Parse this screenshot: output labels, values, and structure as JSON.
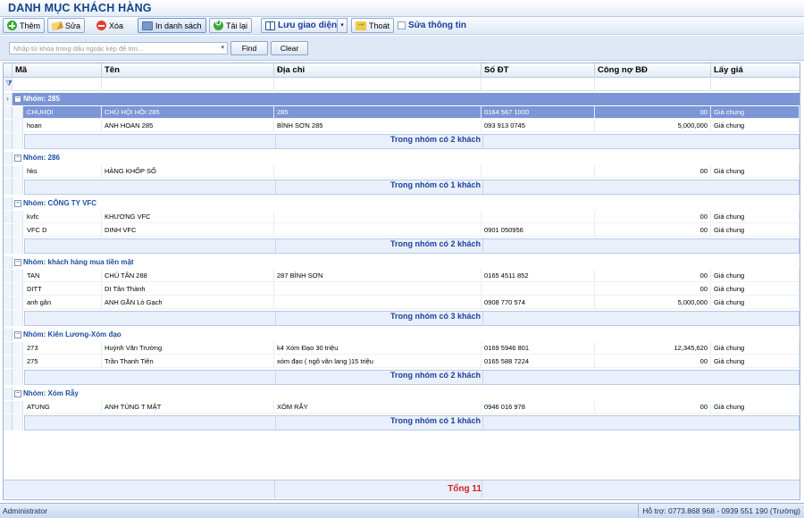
{
  "window": {
    "title": "DANH MỤC KHÁCH HÀNG"
  },
  "toolbar": {
    "add": "Thêm",
    "edit": "Sửa",
    "delete": "Xóa",
    "print_list": "In danh sách",
    "reload": "Tải lại",
    "save_layout": "Lưu giao diện",
    "exit": "Thoát",
    "edit_info": "Sửa thông tin"
  },
  "search": {
    "placeholder": "Nhập từ khóa trong dấu ngoặc kép để tìm...",
    "find_label": "Find",
    "clear_label": "Clear"
  },
  "columns": [
    "Mã",
    "Tên",
    "Địa chỉ",
    "Số ĐT",
    "Công nợ BĐ",
    "Lấy giá"
  ],
  "groups": [
    {
      "label": "Nhóm: 285",
      "rows": [
        [
          "CHUHOI",
          "CHÚ HỘI HỒI 285",
          "285",
          "0164 567 1000",
          "00",
          "Giá chung"
        ],
        [
          "hoan",
          "ANH HOAN 285",
          "BÌNH SƠN 285",
          "093 913 0745",
          "5,000,000",
          "Giá chung"
        ]
      ],
      "summary": "Trong nhóm có 2 khách"
    },
    {
      "label": "Nhóm: 286",
      "rows": [
        [
          "hks",
          "HÀNG KHỐP SỐ",
          "",
          "",
          "00",
          "Giá chung"
        ]
      ],
      "summary": "Trong nhóm có 1 khách"
    },
    {
      "label": "Nhóm: CÔNG TY VFC",
      "rows": [
        [
          "kvfc",
          "KHƯƠNG VFC",
          "",
          "",
          "00",
          "Giá chung"
        ],
        [
          "VFC D",
          "DINH VFC",
          "",
          "0901 050956",
          "00",
          "Giá chung"
        ]
      ],
      "summary": "Trong nhóm có 2 khách"
    },
    {
      "label": "Nhóm: khách hàng mua tiền mặt",
      "rows": [
        [
          "TAN",
          "CHÚ TÂN 288",
          "287 BÌNH SƠN",
          "0165 4511 852",
          "00",
          "Giá chung"
        ],
        [
          "DITT",
          "DI Tân Thành",
          "",
          "",
          "00",
          "Giá chung"
        ],
        [
          "anh gân",
          "ANH GẦN Lò Gạch",
          "",
          "0908 770 574",
          "5,000,000",
          "Giá chung"
        ]
      ],
      "summary": "Trong nhóm có 3 khách"
    },
    {
      "label": "Nhóm: Kiên Lương-Xóm đạo",
      "rows": [
        [
          "273",
          "Huỳnh Văn Trường",
          "k4 Xóm Đạo 30 triệu",
          "0169 5946 801",
          "12,345,620",
          "Giá chung"
        ],
        [
          "275",
          "Trần Thanh Tiên",
          "xóm đạo ( ngõ văn lang )15 triệu",
          "0165 588 7224",
          "00",
          "Giá chung"
        ]
      ],
      "summary": "Trong nhóm có 2 khách"
    },
    {
      "label": "Nhóm: Xóm Rẫy",
      "rows": [
        [
          "ATUNG",
          "ANH TÙNG T MẬT",
          "XÓM RẪY",
          "0946 016 978",
          "00",
          "Giá chung"
        ]
      ],
      "summary": "Trong nhóm có 1 khách"
    }
  ],
  "footer": {
    "total": "Tổng 11"
  },
  "status": {
    "user": "Administrator",
    "support": "Hỗ trợ: 0773.868 968 - 0939 551 190 (Trường)"
  }
}
